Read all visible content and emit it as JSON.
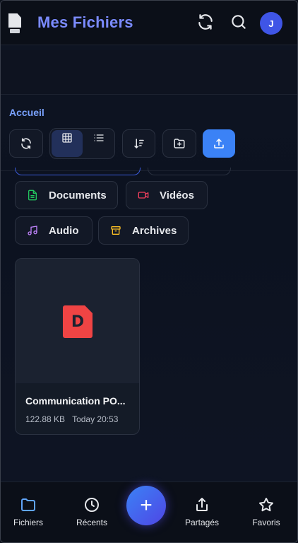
{
  "header": {
    "title": "Mes Fichiers",
    "avatar_initial": "J"
  },
  "breadcrumb": {
    "current": "Accueil"
  },
  "filters": [
    {
      "label": "Documents",
      "icon": "document-icon",
      "color": "#22c55e"
    },
    {
      "label": "Vidéos",
      "icon": "video-icon",
      "color": "#f43f5e"
    },
    {
      "label": "Audio",
      "icon": "music-icon",
      "color": "#c084fc"
    },
    {
      "label": "Archives",
      "icon": "archive-icon",
      "color": "#fbbf24"
    }
  ],
  "files": [
    {
      "name": "Communication PO...",
      "size": "122.88 KB",
      "date": "Today 20:53",
      "type": "pdf",
      "badge": "D"
    }
  ],
  "bottom_nav": [
    {
      "label": "Fichiers",
      "icon": "folder-icon",
      "active": true
    },
    {
      "label": "Récents",
      "icon": "clock-icon",
      "active": false
    },
    {
      "label": "Partagés",
      "icon": "share-icon",
      "active": false
    },
    {
      "label": "Favoris",
      "icon": "star-icon",
      "active": false
    }
  ],
  "fab": {
    "label": "+"
  },
  "colors": {
    "accent": "#3b82f6",
    "title": "#7b8bff",
    "background": "#0c111b"
  }
}
